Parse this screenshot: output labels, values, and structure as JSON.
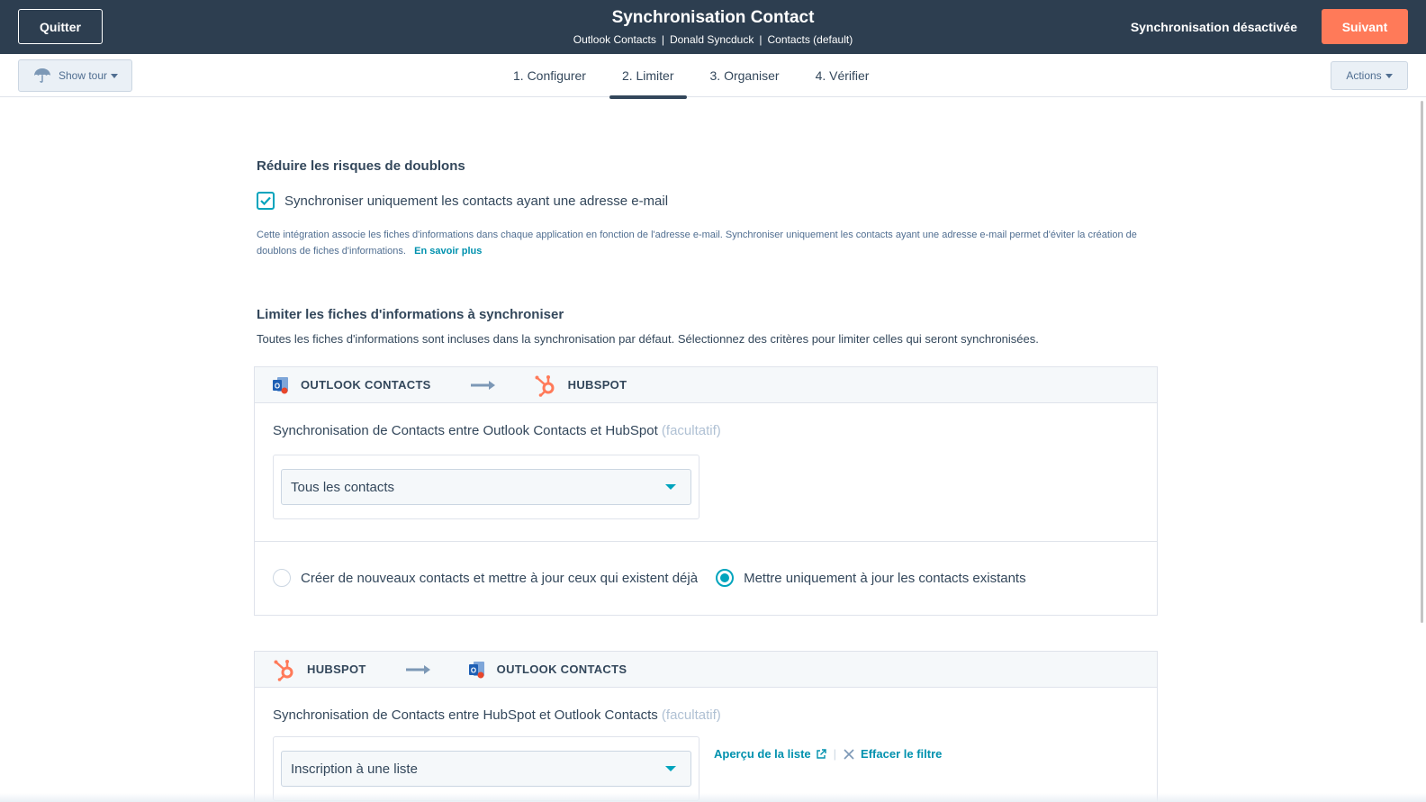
{
  "header": {
    "quit_label": "Quitter",
    "title": "Synchronisation Contact",
    "breadcrumb": [
      "Outlook Contacts",
      "Donald Syncduck",
      "Contacts (default)"
    ],
    "sync_status": "Synchronisation désactivée",
    "next_label": "Suivant",
    "colors": {
      "bar": "#2d3e50",
      "next": "#ff7a59"
    }
  },
  "subnav": {
    "show_tour_label": "Show tour",
    "tabs": [
      {
        "label": "1. Configurer",
        "active": false
      },
      {
        "label": "2. Limiter",
        "active": true
      },
      {
        "label": "3. Organiser",
        "active": false
      },
      {
        "label": "4. Vérifier",
        "active": false
      }
    ],
    "actions_label": "Actions"
  },
  "duplicates": {
    "title": "Réduire les risques de doublons",
    "checkbox_label": "Synchroniser uniquement les contacts ayant une adresse e-mail",
    "checked": true,
    "help_text": "Cette intégration associe les fiches d'informations dans chaque application en fonction de l'adresse e-mail. Synchroniser uniquement les contacts ayant une adresse e-mail permet d'éviter la création de doublons de fiches d'informations.",
    "learn_more": "En savoir plus"
  },
  "limit": {
    "title": "Limiter les fiches d'informations à synchroniser",
    "description": "Toutes les fiches d'informations sont incluses dans la synchronisation par défaut. Sélectionnez des critères pour limiter celles qui seront synchronisées.",
    "panel1": {
      "from": "OUTLOOK CONTACTS",
      "to": "HUBSPOT",
      "field_label": "Synchronisation de Contacts entre Outlook Contacts et HubSpot",
      "optional": "(facultatif)",
      "select_value": "Tous les contacts",
      "radio_create": "Créer de nouveaux contacts et mettre à jour ceux qui existent déjà",
      "radio_update": "Mettre uniquement à jour les contacts existants",
      "selected_radio": "update"
    },
    "panel2": {
      "from": "HUBSPOT",
      "to": "OUTLOOK CONTACTS",
      "field_label": "Synchronisation de Contacts entre HubSpot et Outlook Contacts",
      "optional": "(facultatif)",
      "select_value": "Inscription à une liste",
      "preview_link": "Aperçu de la liste",
      "clear_filter": "Effacer le filtre"
    }
  },
  "icons": {
    "outlook": "outlook-icon",
    "hubspot": "hubspot-sprocket-icon",
    "arrow": "arrow-right-icon",
    "external": "external-link-icon",
    "close": "close-icon",
    "umbrella": "umbrella-icon"
  },
  "accent_color": "#00a4bd"
}
